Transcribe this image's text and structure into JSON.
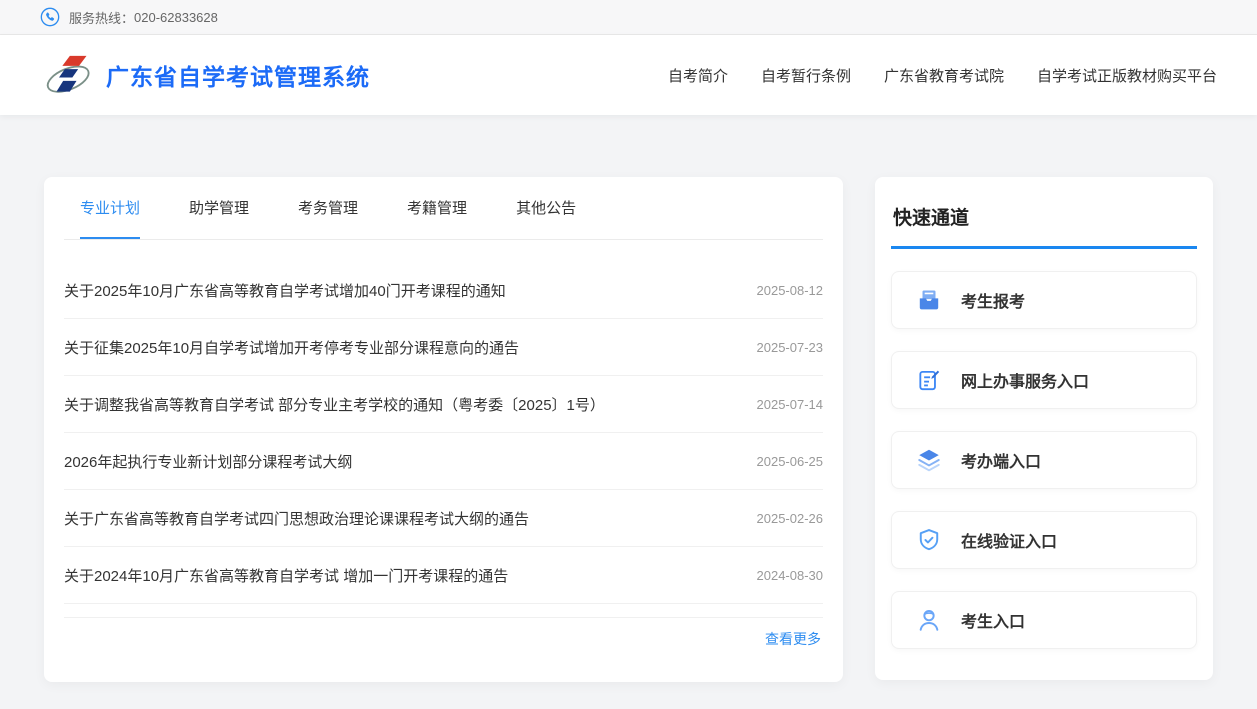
{
  "topbar": {
    "hotline_label": "服务热线：",
    "hotline_number": "020-62833628"
  },
  "header": {
    "site_title": "广东省自学考试管理系统",
    "nav": [
      {
        "label": "自考简介"
      },
      {
        "label": "自考暂行条例"
      },
      {
        "label": "广东省教育考试院"
      },
      {
        "label": "自学考试正版教材购买平台"
      }
    ]
  },
  "notice_panel": {
    "tabs": [
      {
        "label": "专业计划",
        "active": true
      },
      {
        "label": "助学管理",
        "active": false
      },
      {
        "label": "考务管理",
        "active": false
      },
      {
        "label": "考籍管理",
        "active": false
      },
      {
        "label": "其他公告",
        "active": false
      }
    ],
    "items": [
      {
        "title": "关于2025年10月广东省高等教育自学考试增加40门开考课程的通知",
        "date": "2025-08-12"
      },
      {
        "title": "关于征集2025年10月自学考试增加开考停考专业部分课程意向的通告",
        "date": "2025-07-23"
      },
      {
        "title": "关于调整我省高等教育自学考试 部分专业主考学校的通知（粤考委〔2025〕1号）",
        "date": "2025-07-14"
      },
      {
        "title": "2026年起执行专业新计划部分课程考试大纲",
        "date": "2025-06-25"
      },
      {
        "title": "关于广东省高等教育自学考试四门思想政治理论课课程考试大纲的通告",
        "date": "2025-02-26"
      },
      {
        "title": "关于2024年10月广东省高等教育自学考试 增加一门开考课程的通告",
        "date": "2024-08-30"
      }
    ],
    "more_label": "查看更多"
  },
  "quick_panel": {
    "title": "快速通道",
    "items": [
      {
        "label": "考生报考",
        "icon": "inbox-icon"
      },
      {
        "label": "网上办事服务入口",
        "icon": "form-edit-icon"
      },
      {
        "label": "考办端入口",
        "icon": "layers-icon"
      },
      {
        "label": "在线验证入口",
        "icon": "shield-check-icon"
      },
      {
        "label": "考生入口",
        "icon": "user-icon"
      }
    ]
  },
  "colors": {
    "accent_blue": "#2d8cf0",
    "title_blue": "#1c6bf7",
    "icon_blue": "#4a86e8",
    "date_gray": "#999999"
  }
}
